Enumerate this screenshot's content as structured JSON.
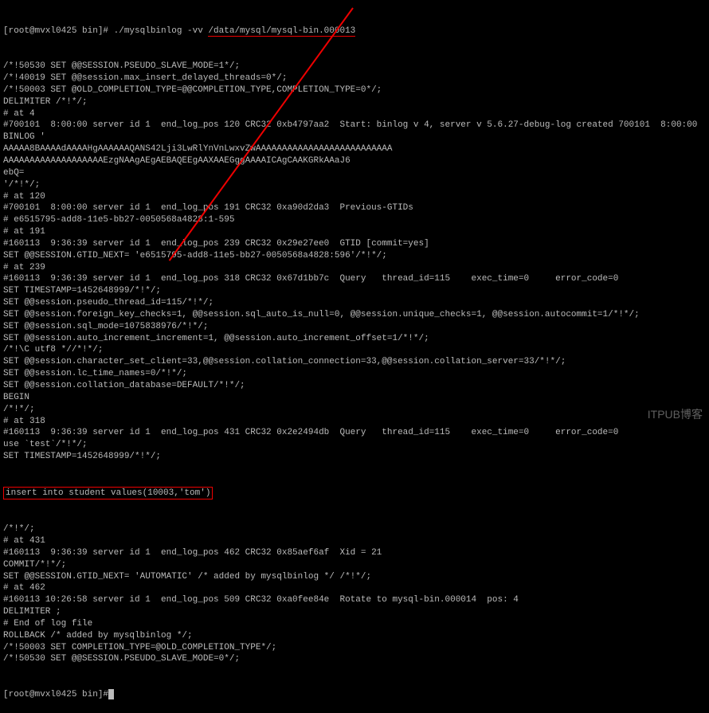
{
  "prompt": "[root@mvxl0425 bin]# ",
  "cmd1": "./mysqlbinlog -vv ",
  "cmd1_path": "/data/mysql/mysql-bin.000013",
  "lines": [
    "/*!50530 SET @@SESSION.PSEUDO_SLAVE_MODE=1*/;",
    "/*!40019 SET @@session.max_insert_delayed_threads=0*/;",
    "/*!50003 SET @OLD_COMPLETION_TYPE=@@COMPLETION_TYPE,COMPLETION_TYPE=0*/;",
    "DELIMITER /*!*/;",
    "# at 4",
    "#700101  8:00:00 server id 1  end_log_pos 120 CRC32 0xb4797aa2  Start: binlog v 4, server v 5.6.27-debug-log created 700101  8:00:00",
    "BINLOG '",
    "AAAAA8BAAAAdAAAAHgAAAAAAQANS42Lji3LwRlYnVnLwxvZwAAAAAAAAAAAAAAAAAAAAAAAAAA",
    "AAAAAAAAAAAAAAAAAAAEzgNAAgAEgAEBAQEEgAAXAAEGggAAAAICAgCAAKGRkAAaJ6",
    "ebQ=",
    "'/*!*/;",
    "# at 120",
    "#700101  8:00:00 server id 1  end_log_pos 191 CRC32 0xa90d2da3  Previous-GTIDs",
    "# e6515795-add8-11e5-bb27-0050568a4828:1-595",
    "# at 191",
    "#160113  9:36:39 server id 1  end_log_pos 239 CRC32 0x29e27ee0  GTID [commit=yes]",
    "SET @@SESSION.GTID_NEXT= 'e6515795-add8-11e5-bb27-0050568a4828:596'/*!*/;",
    "# at 239",
    "#160113  9:36:39 server id 1  end_log_pos 318 CRC32 0x67d1bb7c  Query   thread_id=115    exec_time=0     error_code=0",
    "SET TIMESTAMP=1452648999/*!*/;",
    "SET @@session.pseudo_thread_id=115/*!*/;",
    "SET @@session.foreign_key_checks=1, @@session.sql_auto_is_null=0, @@session.unique_checks=1, @@session.autocommit=1/*!*/;",
    "SET @@session.sql_mode=1075838976/*!*/;",
    "SET @@session.auto_increment_increment=1, @@session.auto_increment_offset=1/*!*/;",
    "/*!\\C utf8 *//*!*/;",
    "SET @@session.character_set_client=33,@@session.collation_connection=33,@@session.collation_server=33/*!*/;",
    "SET @@session.lc_time_names=0/*!*/;",
    "SET @@session.collation_database=DEFAULT/*!*/;",
    "BEGIN",
    "/*!*/;",
    "# at 318",
    "#160113  9:36:39 server id 1  end_log_pos 431 CRC32 0x2e2494db  Query   thread_id=115    exec_time=0     error_code=0",
    "use `test`/*!*/;",
    "SET TIMESTAMP=1452648999/*!*/;"
  ],
  "highlighted_sql": "insert into student values(10003,'tom')",
  "lines2": [
    "/*!*/;",
    "# at 431",
    "#160113  9:36:39 server id 1  end_log_pos 462 CRC32 0x85aef6af  Xid = 21",
    "COMMIT/*!*/;",
    "SET @@SESSION.GTID_NEXT= 'AUTOMATIC' /* added by mysqlbinlog */ /*!*/;",
    "# at 462",
    "#160113 10:26:58 server id 1  end_log_pos 509 CRC32 0xa0fee84e  Rotate to mysql-bin.000014  pos: 4",
    "DELIMITER ;",
    "# End of log file",
    "ROLLBACK /* added by mysqlbinlog */;",
    "/*!50003 SET COMPLETION_TYPE=@OLD_COMPLETION_TYPE*/;",
    "/*!50530 SET @@SESSION.PSEUDO_SLAVE_MODE=0*/;"
  ],
  "prompt_end": "[root@mvxl0425 bin]#",
  "watermark": "ITPUB博客"
}
